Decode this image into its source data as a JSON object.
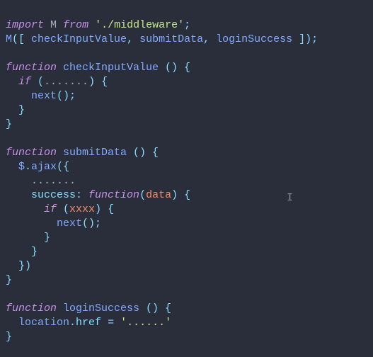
{
  "line1": {
    "import": "import",
    "M": "M",
    "from": "from",
    "path": "'./middleware'",
    "semi": ";"
  },
  "line2": {
    "M": "M",
    "open": "([ ",
    "a": "checkInputValue",
    "c1": ", ",
    "b": "submitData",
    "c2": ", ",
    "c": "loginSuccess",
    "close": " ])"
  },
  "fn1": {
    "kw": "function",
    "name": " checkInputValue ",
    "sig": "() {",
    "ifkw": "if",
    "ifcond": " (",
    "dots": ".......",
    "ifclose": ") {",
    "next": "next",
    "nextcall": "();",
    "brace_inner": "}",
    "brace_outer": "}"
  },
  "fn2": {
    "kw": "function",
    "name": " submitData ",
    "sig": "() {",
    "jq": "$",
    "dot": ".",
    "ajax": "ajax",
    "open": "({",
    "dots": ".......",
    "succkey": "success",
    "colon": ": ",
    "fnkw": "function",
    "fnsig": "(",
    "arg": "data",
    "fnsig2": ") {",
    "ifkw": "if",
    "ifopen": " (",
    "xxxx": "xxxx",
    "ifclose": ") {",
    "next": "next",
    "nextcall": "();",
    "br1": "}",
    "br2": "}",
    "br3": "})",
    "br4": "}"
  },
  "fn3": {
    "kw": "function",
    "name": " loginSuccess ",
    "sig": "() {",
    "loc": "location",
    "dot": ".",
    "href": "href",
    "eq": " = ",
    "str": "'......'",
    "brace": "}"
  },
  "ibeam_glyph": "I"
}
